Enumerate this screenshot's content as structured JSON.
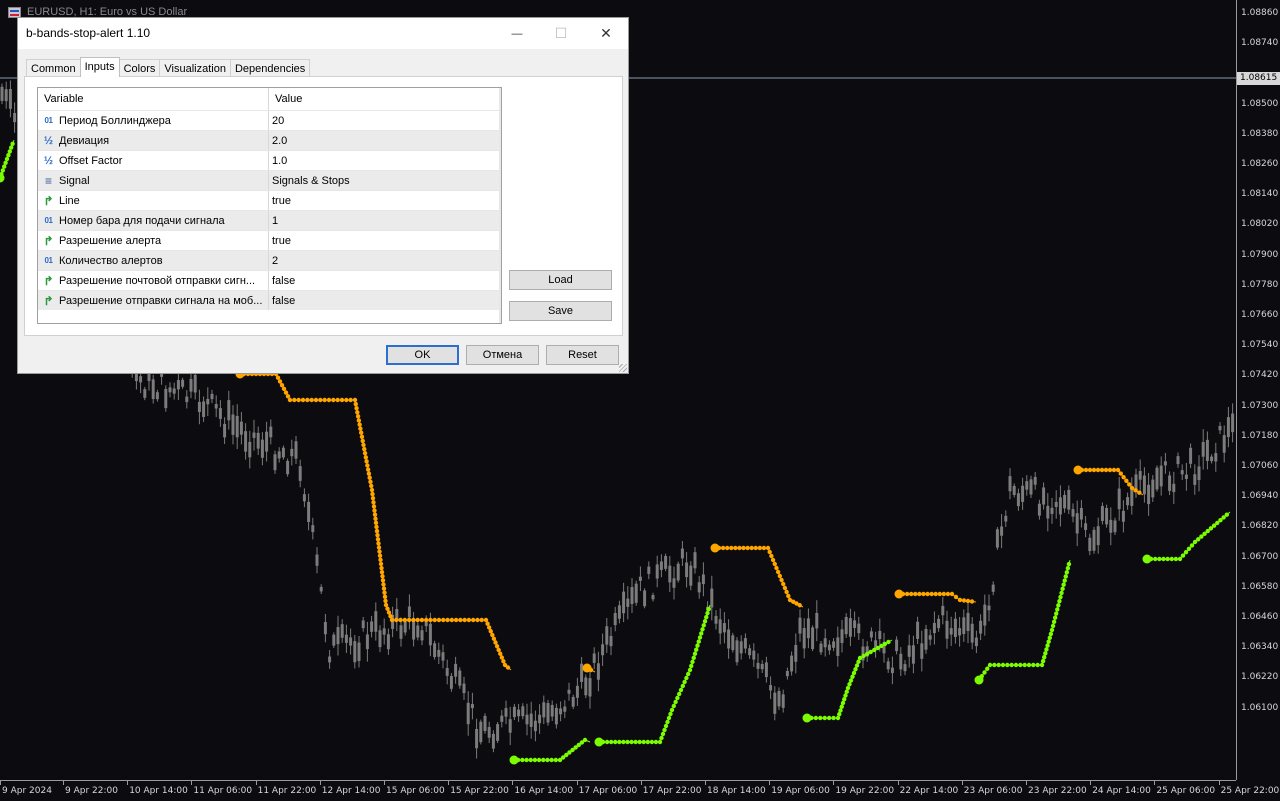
{
  "chart": {
    "title": "EURUSD, H1:  Euro vs US Dollar",
    "current_price": "1.08615",
    "price_labels": [
      "1.08860",
      "1.08740",
      "1.08615",
      "1.08500",
      "1.08380",
      "1.08260",
      "1.08140",
      "1.08020",
      "1.07900",
      "1.07780",
      "1.07660",
      "1.07540",
      "1.07420",
      "1.07300",
      "1.07180",
      "1.07060",
      "1.06940",
      "1.06820",
      "1.06700",
      "1.06580",
      "1.06460",
      "1.06340",
      "1.06220",
      "1.06100"
    ],
    "time_labels": [
      "9 Apr 2024",
      "9 Apr 22:00",
      "10 Apr 14:00",
      "11 Apr 06:00",
      "11 Apr 22:00",
      "12 Apr 14:00",
      "15 Apr 06:00",
      "15 Apr 22:00",
      "16 Apr 14:00",
      "17 Apr 06:00",
      "17 Apr 22:00",
      "18 Apr 14:00",
      "19 Apr 06:00",
      "19 Apr 22:00",
      "22 Apr 14:00",
      "23 Apr 06:00",
      "23 Apr 22:00",
      "24 Apr 14:00",
      "25 Apr 06:00",
      "25 Apr 22:00"
    ],
    "colors": {
      "background": "#0b0b10",
      "candle": "#7c7c7c",
      "resistance": "#ffa500",
      "support": "#7cfc00"
    }
  },
  "dialog": {
    "title": "b-bands-stop-alert 1.10",
    "tabs": [
      "Common",
      "Inputs",
      "Colors",
      "Visualization",
      "Dependencies"
    ],
    "active_tab": "Inputs",
    "columns": {
      "variable": "Variable",
      "value": "Value"
    },
    "params": [
      {
        "icon": "int-icon",
        "glyph": "01",
        "name": "Период Боллинджера",
        "value": "20"
      },
      {
        "icon": "double-icon",
        "glyph": "½",
        "name": "Девиация",
        "value": "2.0"
      },
      {
        "icon": "double-icon",
        "glyph": "½",
        "name": "Offset Factor",
        "value": "1.0"
      },
      {
        "icon": "enum-icon",
        "glyph": "≡",
        "name": "Signal",
        "value": "Signals & Stops"
      },
      {
        "icon": "bool-icon",
        "glyph": "↱",
        "name": "Line",
        "value": "true"
      },
      {
        "icon": "int-icon",
        "glyph": "01",
        "name": "Номер бара для подачи сигнала",
        "value": "1"
      },
      {
        "icon": "bool-icon",
        "glyph": "↱",
        "name": "Разрешение алерта",
        "value": "true"
      },
      {
        "icon": "int-icon",
        "glyph": "01",
        "name": "Количество алертов",
        "value": "2"
      },
      {
        "icon": "bool-icon",
        "glyph": "↱",
        "name": "Разрешение почтовой отправки сигн...",
        "value": "false"
      },
      {
        "icon": "bool-icon",
        "glyph": "↱",
        "name": "Разрешение отправки сигнала на моб...",
        "value": "false"
      }
    ],
    "buttons": {
      "load": "Load",
      "save": "Save",
      "ok": "OK",
      "cancel": "Отмена",
      "reset": "Reset"
    },
    "window_controls": {
      "minimize": "—",
      "maximize": "☐",
      "close": "✕"
    }
  }
}
